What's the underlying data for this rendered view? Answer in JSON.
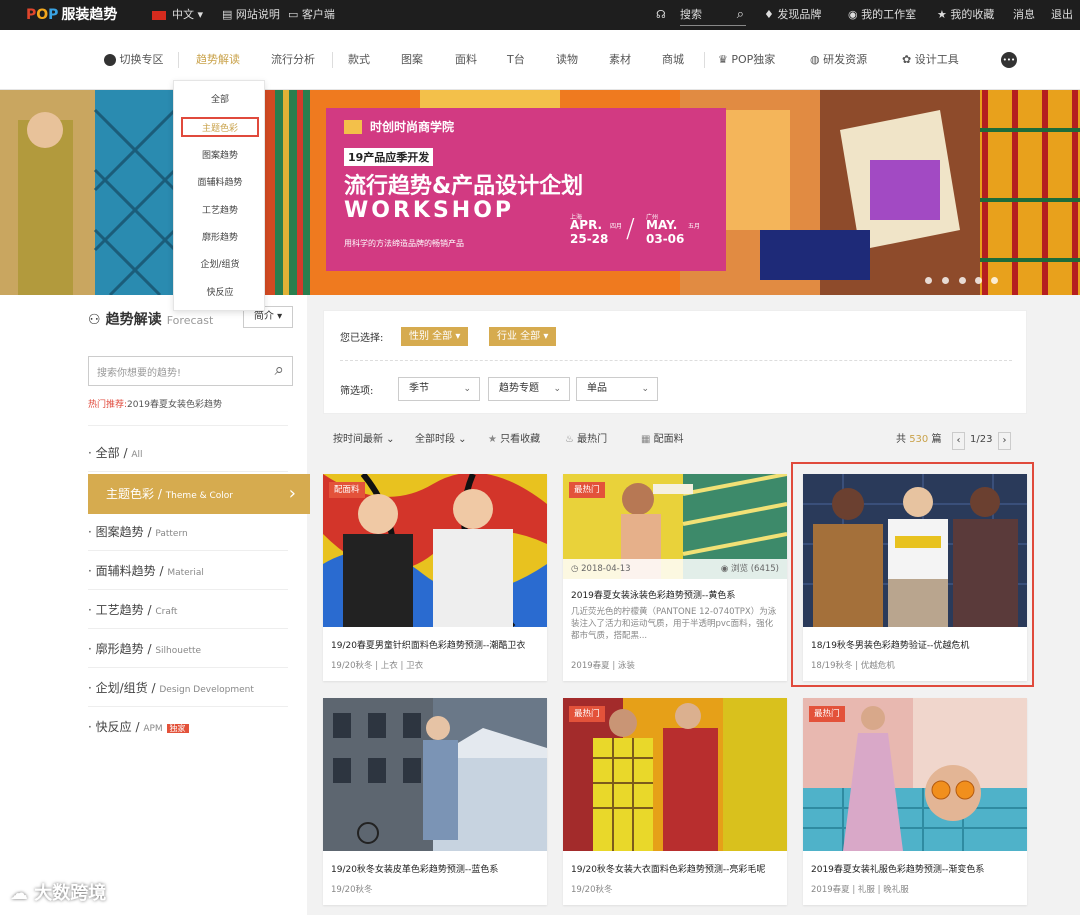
{
  "topbar": {
    "logo": {
      "p": "P",
      "o": "O",
      "p2": "P",
      "brand": "服装趋势"
    },
    "language": "中文",
    "site_guide": "网站说明",
    "client": "客户端",
    "search_label": "搜索",
    "discover_brand": "发现品牌",
    "my_studio": "我的工作室",
    "my_favorites": "我的收藏",
    "messages": "消息",
    "logout": "退出"
  },
  "nav": {
    "switch_zone": "切换专区",
    "items": [
      "趋势解读",
      "流行分析",
      "款式",
      "图案",
      "面料",
      "T台",
      "读物",
      "素材",
      "商城"
    ],
    "pop_exclusive": "POP独家",
    "rd_resources": "研发资源",
    "design_tools": "设计工具",
    "more": "•••"
  },
  "dropdown": [
    "全部",
    "主题色彩",
    "图案趋势",
    "面辅料趋势",
    "工艺趋势",
    "廓形趋势",
    "企划/组货",
    "快反应"
  ],
  "banner": {
    "brand": "时创时尚商学院",
    "subtitle": "19产品应季开发",
    "title": "流行趋势&产品设计企划",
    "workshop": "WORKSHOP",
    "tagline": "用科学的方法缔造品牌的畅销产品",
    "city1": "上海",
    "date1_month": "APR.",
    "date1_days": "25-28",
    "date1_cn": "四月",
    "city2": "广州",
    "date2_month": "MAY.",
    "date2_days": "03-06",
    "date2_cn": "五月"
  },
  "sidebar": {
    "title": "趋势解读",
    "title_en": "Forecast",
    "intro_button": "简介",
    "search_placeholder": "搜索你想要的趋势!",
    "hot_label": "热门推荐:",
    "hot_item": "2019春夏女装色彩趋势",
    "items": [
      {
        "cn": "全部",
        "en": "All"
      },
      {
        "cn": "主题色彩",
        "en": "Theme & Color"
      },
      {
        "cn": "图案趋势",
        "en": "Pattern"
      },
      {
        "cn": "面辅料趋势",
        "en": "Material"
      },
      {
        "cn": "工艺趋势",
        "en": "Craft"
      },
      {
        "cn": "廓形趋势",
        "en": "Silhouette"
      },
      {
        "cn": "企划/组货",
        "en": "Design Development"
      },
      {
        "cn": "快反应",
        "en": "APM",
        "badge": "独家"
      }
    ]
  },
  "filter": {
    "selected_label": "您已选择:",
    "tag1": "性别  全部",
    "tag2": "行业  全部",
    "options_label": "筛选项:",
    "select1": "季节",
    "select2": "趋势专题",
    "select3": "单品"
  },
  "sortbar": {
    "sort_time": "按时间最新",
    "all_time": "全部时段",
    "only_fav": "只看收藏",
    "hottest": "最热门",
    "material": "配面料",
    "total_prefix": "共",
    "total": "530",
    "total_suffix": "篇",
    "page": "1/23"
  },
  "cards": [
    {
      "badge": "配面料",
      "title": "19/20春夏男童针织面料色彩趋势预测--潮酷卫衣",
      "season": "19/20秋冬",
      "tags": [
        "上衣",
        "卫衣"
      ]
    },
    {
      "badge": "最热门",
      "date": "2018-04-13",
      "views": "浏览 (6415)",
      "title": "2019春夏女装泳装色彩趋势预测--黄色系",
      "desc": "几近荧光色的柠檬黄（PANTONE 12-0740TPX）为泳装注入了活力和运动气质，用于半透明pvc面料，强化都市气质，搭配黑...",
      "season": "2019春夏",
      "tags": [
        "泳装"
      ]
    },
    {
      "title": "18/19秋冬男装色彩趋势验证--优越危机",
      "season": "18/19秋冬",
      "tags": [
        "优越危机"
      ]
    },
    {
      "title": "19/20秋冬女装皮革色彩趋势预测--蓝色系",
      "season": "19/20秋冬",
      "tags": []
    },
    {
      "badge": "最热门",
      "title": "19/20秋冬女装大衣面料色彩趋势预测--亮彩毛呢",
      "season": "19/20秋冬",
      "tags": []
    },
    {
      "badge": "最热门",
      "title": "2019春夏女装礼服色彩趋势预测--渐变色系",
      "season": "2019春夏",
      "tags": [
        "礼服",
        "晚礼服"
      ]
    }
  ],
  "watermark": "大数跨境"
}
